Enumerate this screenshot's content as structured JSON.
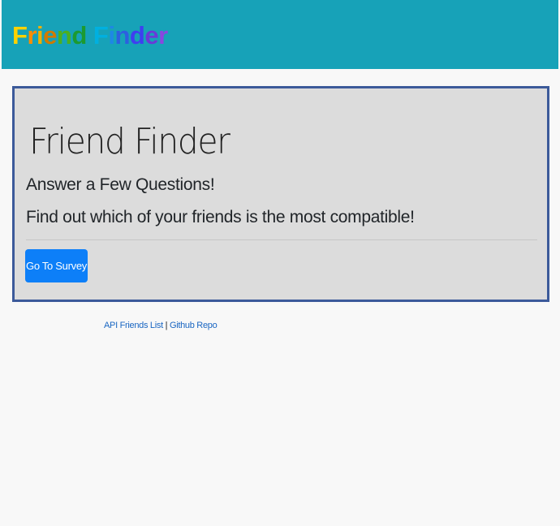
{
  "navbar": {
    "brand_letters": [
      {
        "char": "F",
        "color": "#ffd200"
      },
      {
        "char": "r",
        "color": "#ff8c00"
      },
      {
        "char": "i",
        "color": "#f0b000"
      },
      {
        "char": "e",
        "color": "#d07a00"
      },
      {
        "char": "n",
        "color": "#4caf20"
      },
      {
        "char": "d",
        "color": "#1c9a30"
      },
      {
        "char": " ",
        "color": "#000000"
      },
      {
        "char": "F",
        "color": "#00b0e0"
      },
      {
        "char": "i",
        "color": "#1e88e5"
      },
      {
        "char": "n",
        "color": "#2d5fe0"
      },
      {
        "char": "d",
        "color": "#3f3ff0"
      },
      {
        "char": "e",
        "color": "#6a3ad8"
      },
      {
        "char": "r",
        "color": "#8a46e0"
      }
    ],
    "background": "#17a2b8"
  },
  "jumbotron": {
    "title": "Friend Finder",
    "lead1": "Answer a Few Questions!",
    "lead2": "Find out which of your friends is the most compatible!",
    "button_label": "Go To Survey",
    "border_color": "#3c5a9a",
    "button_color": "#0d7ff8"
  },
  "footer": {
    "link1": "API Friends List",
    "separator": "|",
    "link2": "Github Repo"
  }
}
